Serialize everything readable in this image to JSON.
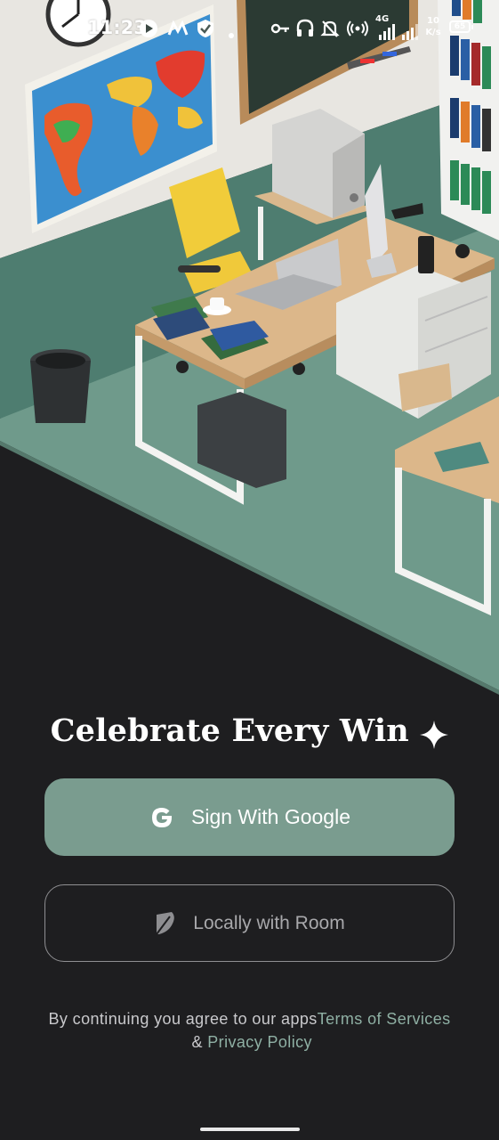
{
  "status_bar": {
    "time": "11:23",
    "network_type": "4G",
    "speed_value": "10",
    "speed_unit": "K/s",
    "battery": "65"
  },
  "headline": {
    "text": "Celebrate Every Win",
    "icon": "sparkle-icon"
  },
  "buttons": {
    "google_label": "Sign With Google",
    "google_icon": "google-icon",
    "room_label": "Locally with Room",
    "room_icon": "feather-icon"
  },
  "terms": {
    "prefix": "By continuing you agree to our apps",
    "terms_link": "Terms of Services",
    "separator": " & ",
    "privacy_link": "Privacy Policy"
  },
  "colors": {
    "background": "#1e1e20",
    "accent": "#7a9c8f",
    "link": "#8fb0a4",
    "floor": "#6f9a8b",
    "wall": "#e6e4df"
  }
}
